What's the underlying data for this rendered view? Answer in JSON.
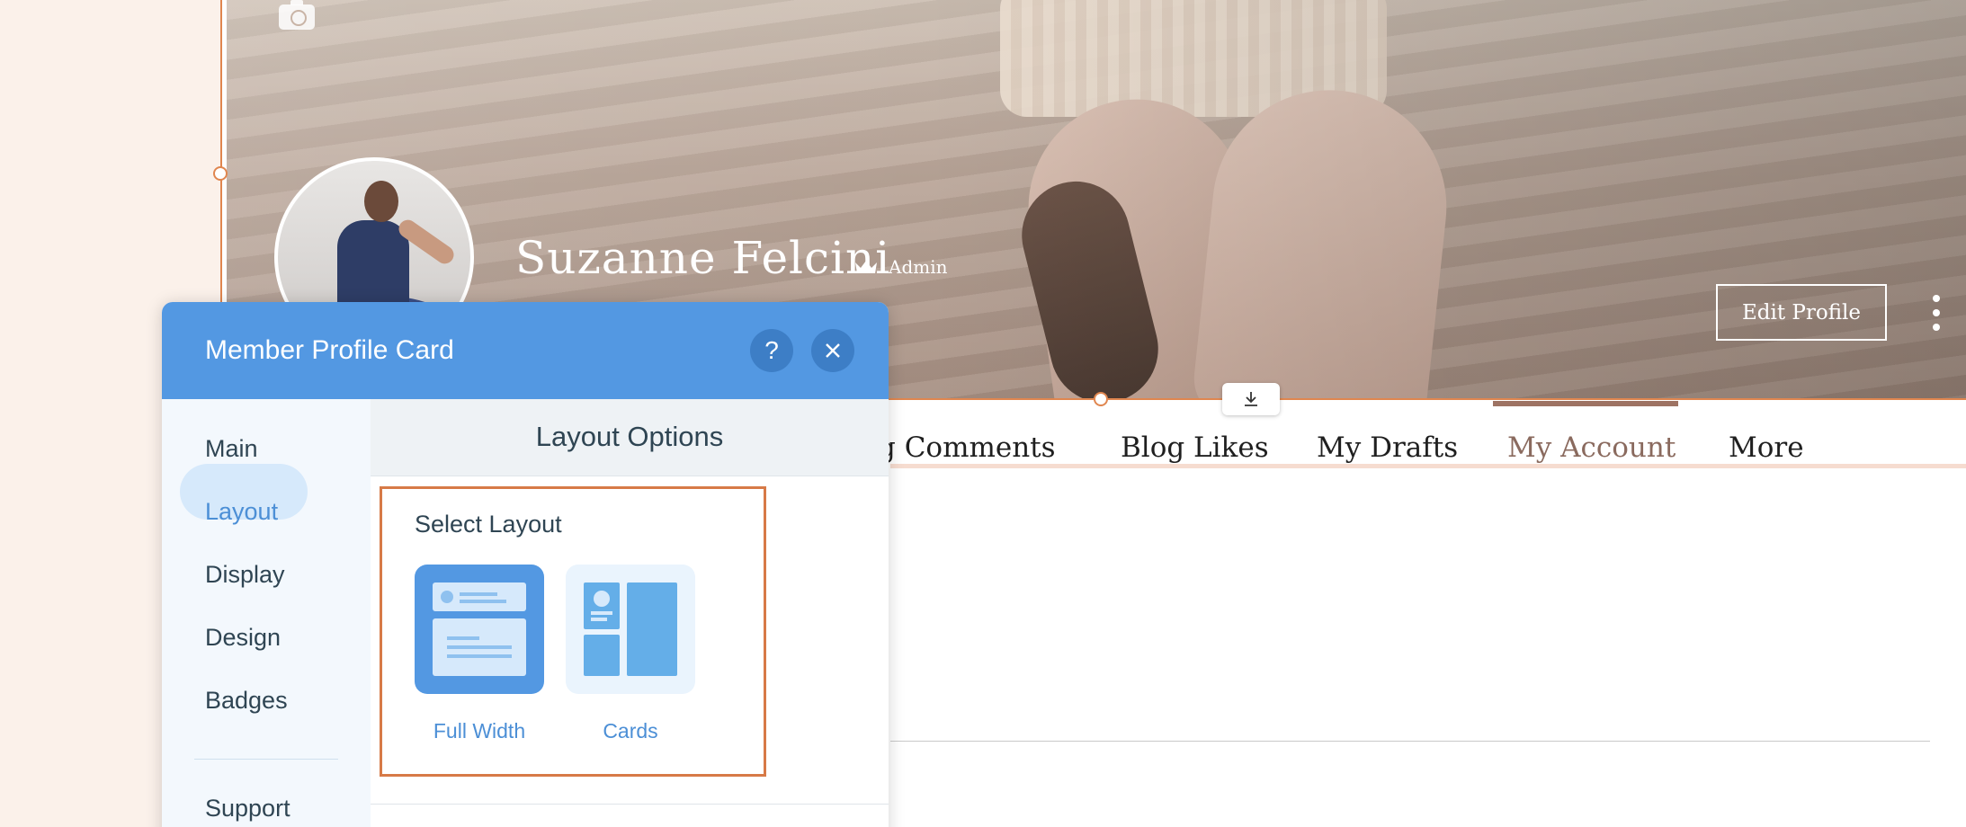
{
  "profile": {
    "name": "Suzanne Felcini",
    "role": "Admin",
    "edit_label": "Edit Profile"
  },
  "tabs": [
    {
      "label": "g Comments"
    },
    {
      "label": "Blog Likes"
    },
    {
      "label": "My Drafts"
    },
    {
      "label": "My Account",
      "active": true
    },
    {
      "label": "More"
    }
  ],
  "panel": {
    "title": "Member Profile Card",
    "help_glyph": "?",
    "close_glyph": "✕",
    "nav": [
      {
        "label": "Main"
      },
      {
        "label": "Layout",
        "active": true
      },
      {
        "label": "Display"
      },
      {
        "label": "Design"
      },
      {
        "label": "Badges"
      },
      {
        "label": "Support"
      }
    ],
    "section_title": "Layout Options",
    "select_label": "Select Layout",
    "layouts": [
      {
        "label": "Full Width",
        "selected": true
      },
      {
        "label": "Cards",
        "selected": false
      }
    ]
  },
  "icons": {
    "camera": "camera-icon",
    "crown": "crown-icon",
    "download": "download-icon",
    "more": "vertical-dots-icon",
    "help": "question-icon",
    "close": "close-icon"
  },
  "colors": {
    "panel_header": "#5398e2",
    "selection_orange": "#d77a47",
    "active_tab": "#8a6a5e",
    "nav_active": "#4c8fd6"
  }
}
